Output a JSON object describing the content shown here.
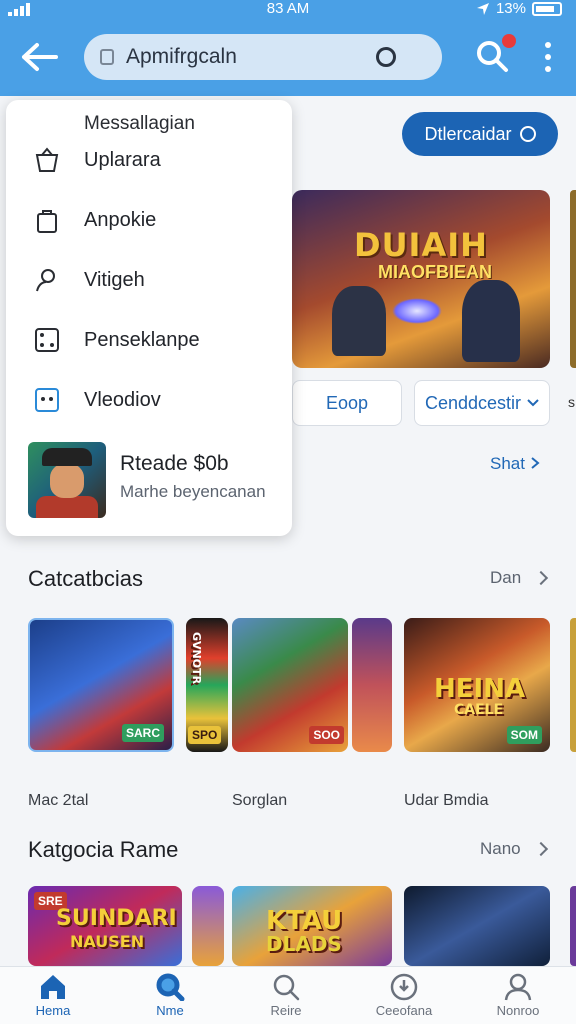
{
  "status": {
    "time": "83 AM",
    "battery": "13%"
  },
  "search": {
    "value": "Apmifrgcaln"
  },
  "dropdown": {
    "header": "Messallagian",
    "items": [
      {
        "label": "Uplarara",
        "icon": "basket-icon"
      },
      {
        "label": "Anpokie",
        "icon": "bag-icon"
      },
      {
        "label": "Vitigeh",
        "icon": "person-icon"
      },
      {
        "label": "Penseklanpe",
        "icon": "dice-icon"
      },
      {
        "label": "Vleodiov",
        "icon": "dice-two-icon"
      }
    ],
    "promo": {
      "title": "Rteade $0b",
      "subtitle": "Marhe beyencanan"
    }
  },
  "download_label": "Dtlercaidar",
  "hero": {
    "title": "DUIAIH",
    "subtitle": "MIAOFBIEAN"
  },
  "chips": {
    "left": "Eoop",
    "right": "Cenddcestir"
  },
  "shat_label": "Shat",
  "right_edge_label": "s",
  "section1": {
    "title": "Catcatbcias",
    "more": "Dan",
    "cards": [
      {
        "label": "Mac 2tal",
        "badge": "SARC"
      },
      {
        "label": "Sorglan",
        "badge": "SOO",
        "side_text": "GVNOTR",
        "side_badge": "SPO"
      },
      {
        "label": "Udar Bmdia",
        "badge": "SOM",
        "art_title": "HEINA",
        "art_sub": "CAELE"
      }
    ]
  },
  "section2": {
    "title": "Katgocia Rame",
    "more": "Nano",
    "cards": [
      {
        "art_title": "SUINDARI",
        "art_sub": "NAUSEN",
        "badge": "SRE"
      },
      {
        "art_title": "KTAU",
        "art_sub": "DLADS"
      }
    ]
  },
  "nav": [
    {
      "label": "Hema",
      "icon": "home-icon",
      "active": true
    },
    {
      "label": "Nme",
      "icon": "search-active-icon",
      "active": false
    },
    {
      "label": "Reire",
      "icon": "magnifier-icon",
      "active": false
    },
    {
      "label": "Ceeofana",
      "icon": "download-icon",
      "active": false
    },
    {
      "label": "Nonroo",
      "icon": "profile-icon",
      "active": false
    }
  ],
  "colors": {
    "appbar": "#4aa0e6",
    "primary": "#1c64b4",
    "badge": "#2f9e5e",
    "notification": "#e83b3b"
  }
}
